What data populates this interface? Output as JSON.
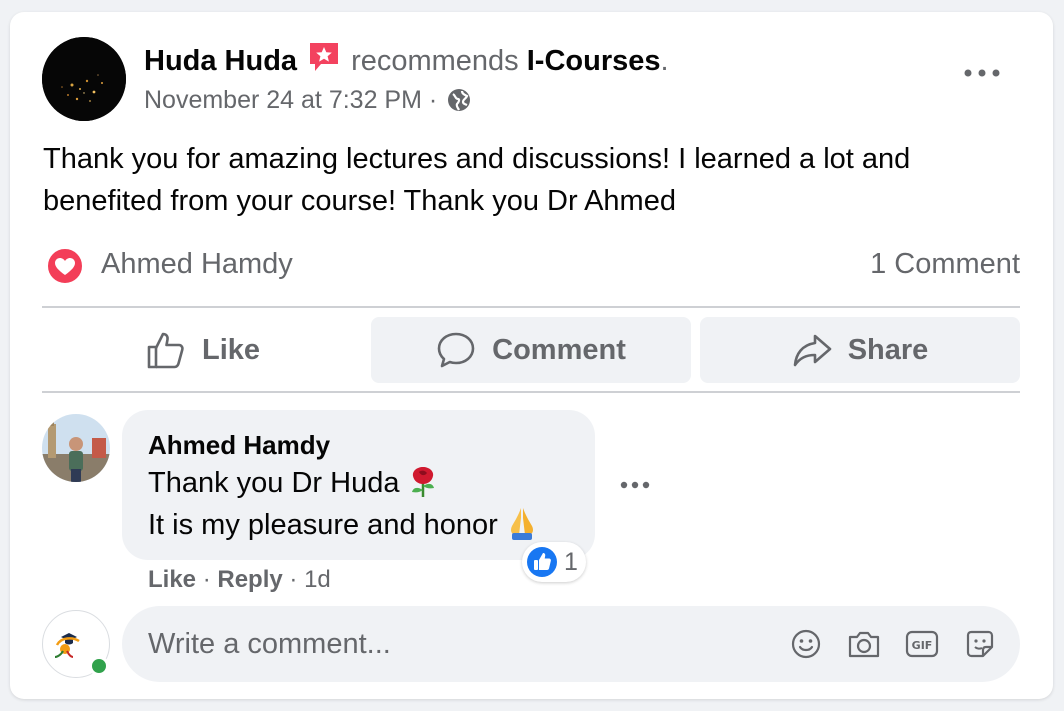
{
  "post": {
    "author": "Huda Huda",
    "verb": "recommends",
    "page": "I-Courses",
    "end_dot": ".",
    "timestamp": "November 24 at 7:32 PM",
    "separator": "·",
    "text": "Thank you for amazing lectures and discussions! I learned a lot and benefited from your course! Thank you Dr Ahmed",
    "reactor": "Ahmed Hamdy",
    "comment_count": "1 Comment"
  },
  "actions": {
    "like": "Like",
    "comment": "Comment",
    "share": "Share"
  },
  "comment": {
    "author": "Ahmed Hamdy",
    "line1": "Thank you Dr Huda",
    "line1_emoji": "rose",
    "line2": "It is my pleasure and honor",
    "line2_emoji": "folded-hands",
    "like_count": "1",
    "like_label": "Like",
    "reply_label": "Reply",
    "age": "1d",
    "sep": "·"
  },
  "composer": {
    "placeholder": "Write a comment..."
  },
  "colors": {
    "secondary_text": "#65676b",
    "divider": "#ced0d4",
    "gray_bg": "#f0f2f5",
    "love_red": "#f33e58",
    "like_blue": "#1877f2",
    "online_green": "#31a24c",
    "recommend_pink": "#f3425f"
  },
  "icons": [
    "recommend-icon",
    "globe-icon",
    "more-icon",
    "love-reaction-icon",
    "like-icon",
    "comment-icon",
    "share-icon",
    "smile-icon",
    "camera-icon",
    "gif-icon",
    "sticker-icon"
  ]
}
